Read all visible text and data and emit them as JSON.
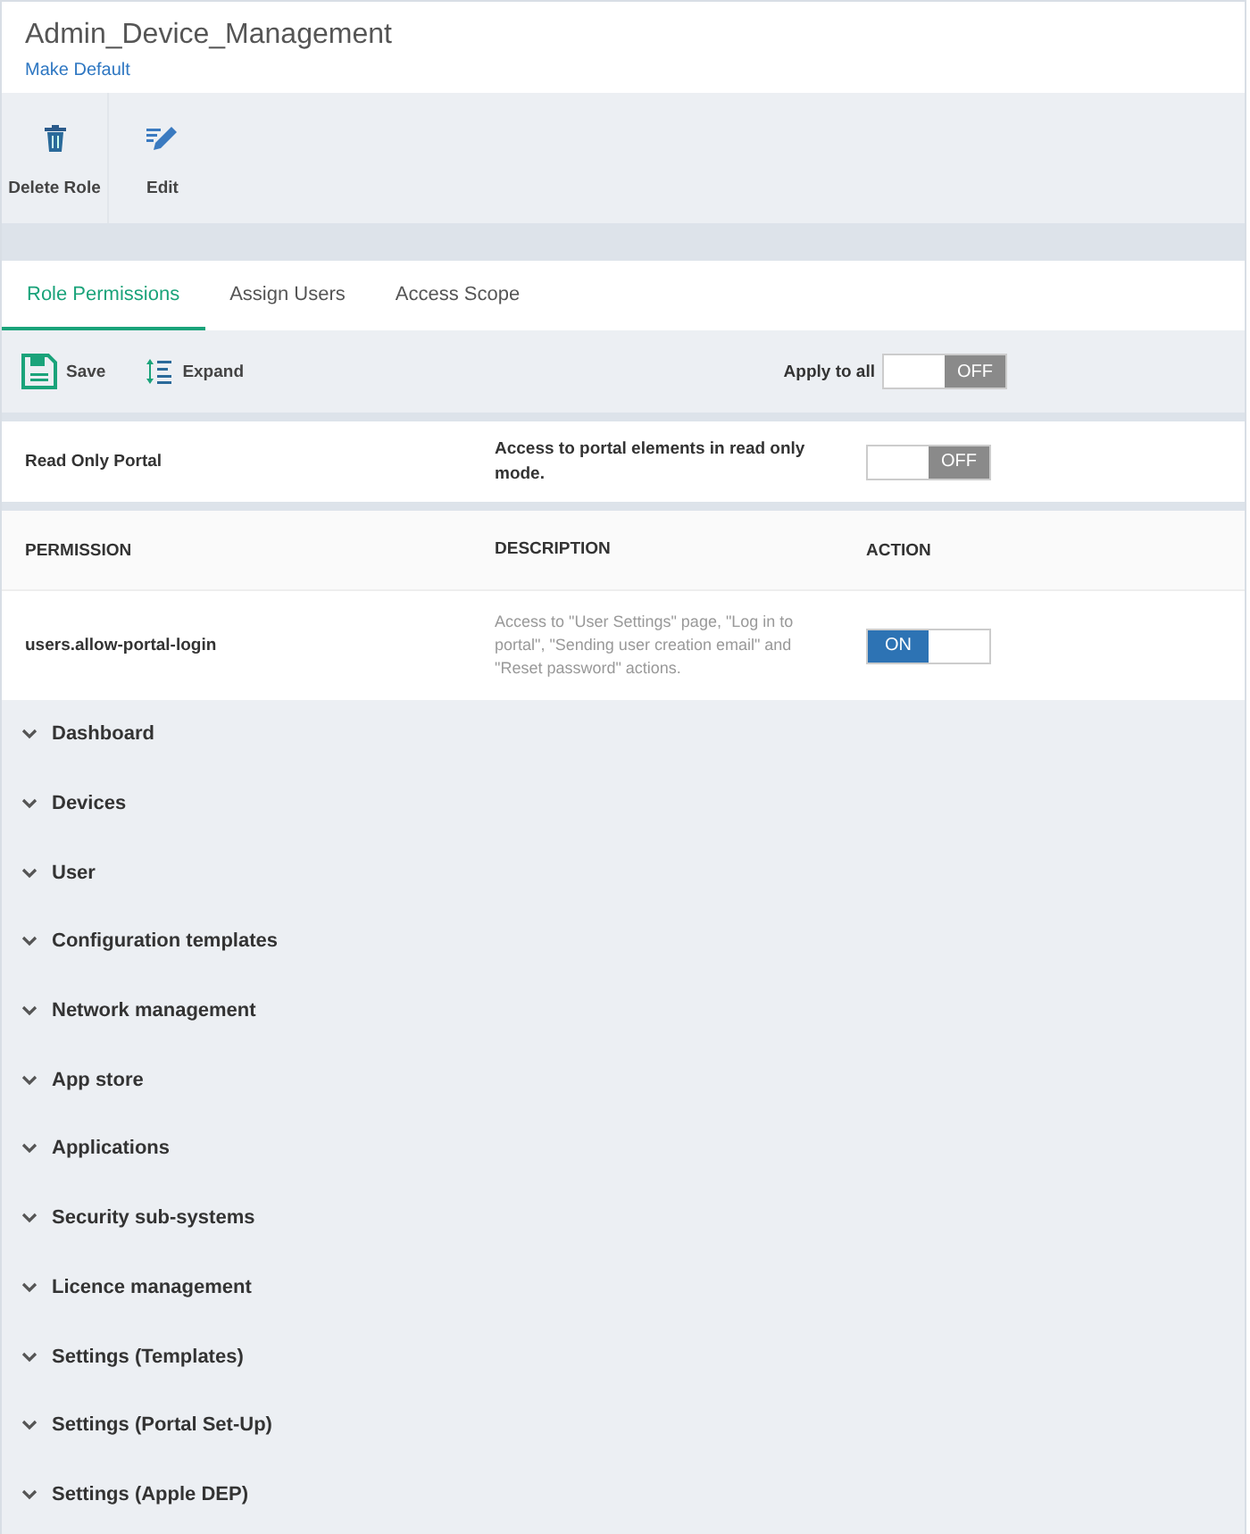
{
  "header": {
    "title": "Admin_Device_Management",
    "link": "Make Default"
  },
  "toolbar": [
    {
      "kind": "delete",
      "label": "Delete Role"
    },
    {
      "kind": "edit",
      "label": "Edit"
    }
  ],
  "tabs": [
    {
      "label": "Role Permissions",
      "selected": true
    },
    {
      "label": "Assign Users",
      "selected": false
    },
    {
      "label": "Access Scope",
      "selected": false
    }
  ],
  "actions": [
    {
      "kind": "save",
      "label": "Save"
    },
    {
      "kind": "expand",
      "label": "Expand"
    }
  ],
  "apply_all": {
    "label": "Apply to all",
    "toggle": {
      "on": false,
      "text": "OFF"
    }
  },
  "read_only": {
    "name": "Read Only Portal",
    "description": "Access to portal elements in read only mode.",
    "toggle": {
      "on": false,
      "text": "OFF"
    }
  },
  "table": {
    "columns": [
      "PERMISSION",
      "DESCRIPTION",
      "ACTION"
    ],
    "rows": [
      {
        "permission": "users.allow-portal-login",
        "description": "Access to \"User Settings\" page, \"Log in to portal\", \"Sending user creation email\" and \"Reset password\" actions.",
        "toggle": {
          "on": true,
          "text": "ON"
        }
      }
    ]
  },
  "sections": [
    {
      "label": "Dashboard",
      "expanded": false
    },
    {
      "label": "Devices",
      "expanded": false
    },
    {
      "label": "User",
      "expanded": false
    },
    {
      "label": "Configuration templates",
      "expanded": false
    },
    {
      "label": "Network management",
      "expanded": false
    },
    {
      "label": "App store",
      "expanded": false
    },
    {
      "label": "Applications",
      "expanded": false
    },
    {
      "label": "Security sub-systems",
      "expanded": false
    },
    {
      "label": "Licence management",
      "expanded": false
    },
    {
      "label": "Settings (Templates)",
      "expanded": false
    },
    {
      "label": "Settings (Portal Set-Up)",
      "expanded": false
    },
    {
      "label": "Settings (Apple DEP)",
      "expanded": false
    }
  ]
}
